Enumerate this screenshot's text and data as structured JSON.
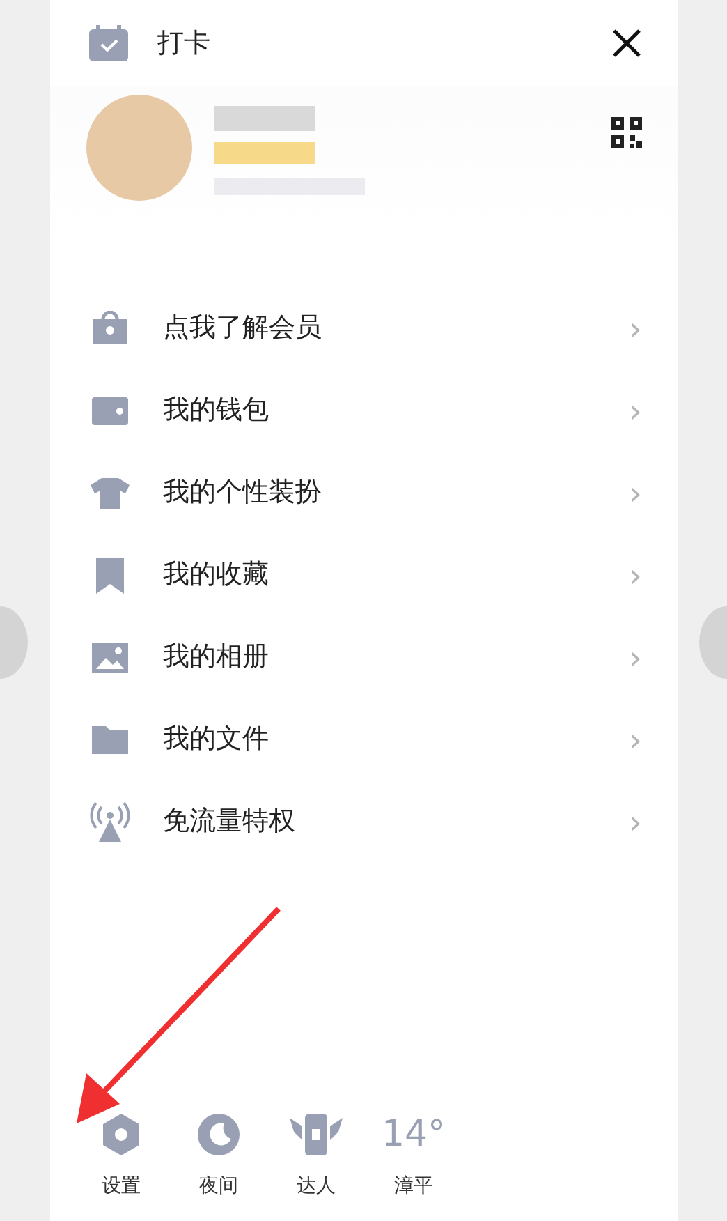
{
  "header": {
    "title": "打卡"
  },
  "menu": [
    {
      "label": "点我了解会员",
      "chevron": "›"
    },
    {
      "label": "我的钱包",
      "chevron": "›"
    },
    {
      "label": "我的个性装扮",
      "chevron": "›"
    },
    {
      "label": "我的收藏",
      "chevron": "›"
    },
    {
      "label": "我的相册",
      "chevron": "›"
    },
    {
      "label": "我的文件",
      "chevron": "›"
    },
    {
      "label": "免流量特权",
      "chevron": "›"
    }
  ],
  "bottom_bar": [
    {
      "kind": "icon",
      "label": "设置"
    },
    {
      "kind": "icon",
      "label": "夜间"
    },
    {
      "kind": "icon",
      "label": "达人"
    },
    {
      "kind": "weather",
      "reading": "14°",
      "label": "漳平"
    }
  ]
}
